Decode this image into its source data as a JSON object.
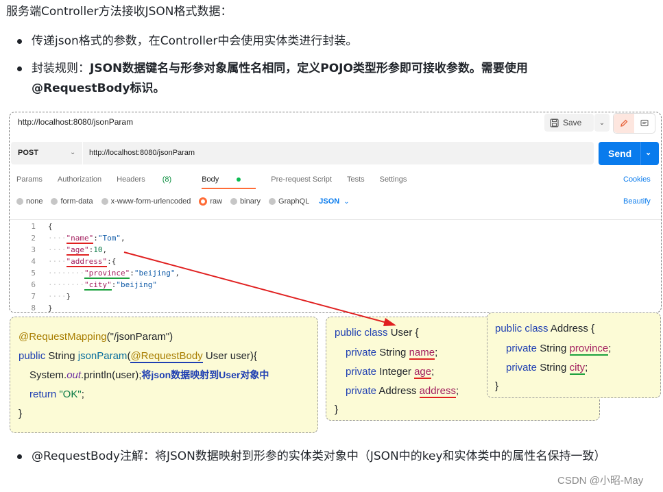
{
  "intro": "服务端Controller方法接收JSON格式数据：",
  "bullets": {
    "b1": "传递json格式的参数，在Controller中会使用实体类进行封装。",
    "b2_prefix": "封装规则：",
    "b2_bold": "JSON数据键名与形参对象属性名相同，定义POJO类型形参即可接收参数。需要使用@RequestBody标识。"
  },
  "postman": {
    "title_url": "http://localhost:8080/jsonParam",
    "save_label": "Save",
    "method": "POST",
    "request_url": "http://localhost:8080/jsonParam",
    "send_label": "Send",
    "tabs": {
      "params": "Params",
      "authorization": "Authorization",
      "headers": "Headers",
      "headers_count": "(8)",
      "body": "Body",
      "prerequest": "Pre-request Script",
      "tests": "Tests",
      "settings": "Settings"
    },
    "cookies_label": "Cookies",
    "body_types": {
      "none": "none",
      "form_data": "form-data",
      "urlencoded": "x-www-form-urlencoded",
      "raw": "raw",
      "binary": "binary",
      "graphql": "GraphQL"
    },
    "format": "JSON",
    "beautify_label": "Beautify",
    "code_lines": {
      "l1": {
        "num": "1",
        "text": "{"
      },
      "l2": {
        "num": "2",
        "key": "\"name\"",
        "value": "\"Tom\""
      },
      "l3": {
        "num": "3",
        "key": "\"age\"",
        "value": "10"
      },
      "l4": {
        "num": "4",
        "key": "\"address\"",
        "value": "{"
      },
      "l5": {
        "num": "5",
        "key": "\"province\"",
        "value": "\"beijing\""
      },
      "l6": {
        "num": "6",
        "key": "\"city\"",
        "value": "\"beijing\""
      },
      "l7": {
        "num": "7",
        "text": "}"
      },
      "l8": {
        "num": "8",
        "text": "}"
      }
    }
  },
  "controller_box": {
    "mapping_annotation": "@RequestMapping",
    "mapping_path": "(\"/jsonParam\")",
    "public_kw": "public",
    "return_type": "String",
    "method_name": "jsonParam",
    "param_annotation": "@RequestBody",
    "param_decl": " User user){",
    "system": "System.",
    "out": "out",
    "println": ".println(user);",
    "note": "将json数据映射到User对象中",
    "return_kw": "return",
    "return_value": "\"OK\"",
    "close": "}"
  },
  "user_box": {
    "public_class": "public class",
    "class_name": " User {",
    "private_kw": "private",
    "f1_type": "String",
    "f1_name": "name",
    "f2_type": "Integer",
    "f2_name": "age",
    "f3_type": "Address",
    "f3_name": "address",
    "semicolon": ";",
    "close": "}"
  },
  "address_box": {
    "public_class": "public class",
    "class_name": " Address {",
    "private_kw": "private",
    "f1_type": "String",
    "f1_name": "province",
    "f2_type": "String",
    "f2_name": "city",
    "semicolon": ";",
    "close": "}"
  },
  "footer": {
    "text": "@RequestBody注解：将JSON数据映射到形参的实体类对象中（JSON中的key和实体类中的属性名保持一致）"
  },
  "watermark": "CSDN @小昭-May",
  "colors": {
    "send_button": "#097bed",
    "active_tab_underline": "#ff6c37",
    "annotation_box": "#fcfbd6",
    "arrow": "#e02020"
  }
}
